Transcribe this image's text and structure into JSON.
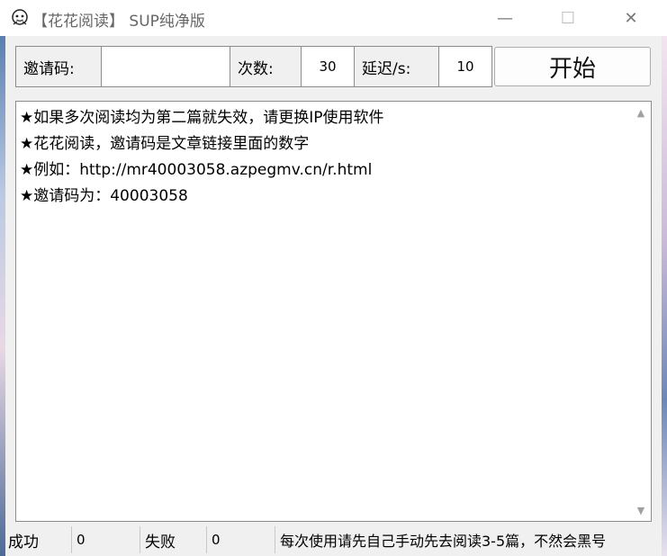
{
  "window": {
    "title": "【花花阅读】 SUP纯净版",
    "icon": "app-face-icon",
    "controls": {
      "minimize": "—",
      "maximize": "☐",
      "close": "✕"
    }
  },
  "toolbar": {
    "invite_label": "邀请码:",
    "invite_value": "",
    "times_label": "次数:",
    "times_value": "30",
    "delay_label": "延迟/s:",
    "delay_value": "10",
    "start_label": "开始"
  },
  "log": {
    "lines": [
      "★如果多次阅读均为第二篇就失效，请更换IP使用软件",
      "★花花阅读，邀请码是文章链接里面的数字",
      "★例如：http://mr40003058.azpegmv.cn/r.html",
      "★邀请码为：40003058"
    ]
  },
  "statusbar": {
    "success_label": "成功",
    "success_value": "0",
    "fail_label": "失败",
    "fail_value": "0",
    "notice": "每次使用请先自己手动先去阅读3-5篇，不然会黑号"
  }
}
